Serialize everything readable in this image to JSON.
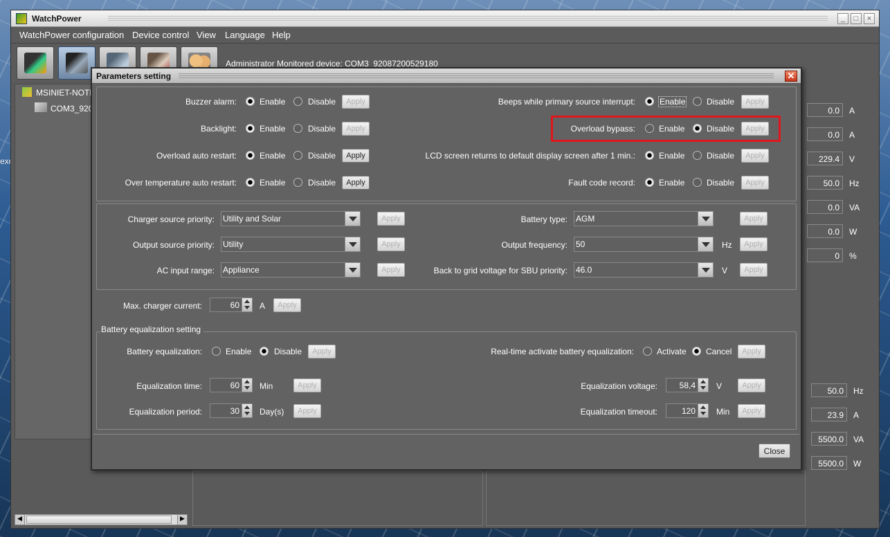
{
  "window": {
    "title": "WatchPower",
    "controls": [
      "_",
      "□",
      "×"
    ]
  },
  "desktop": {
    "text": "exe"
  },
  "menu": [
    "WatchPower configuration",
    "Device control",
    "View",
    "Language",
    "Help"
  ],
  "toolbar": {
    "status": "Administrator   Monitored device:  COM3_92087200529180"
  },
  "tree": {
    "root": "MSINIET-NOTE",
    "child": "COM3_920"
  },
  "side_values": {
    "top": [
      {
        "value": "0.0",
        "unit": "A"
      },
      {
        "value": "0.0",
        "unit": "A"
      },
      {
        "value": "229.4",
        "unit": "V"
      },
      {
        "value": "50.0",
        "unit": "Hz"
      },
      {
        "value": "0.0",
        "unit": "VA"
      },
      {
        "value": "0.0",
        "unit": "W"
      },
      {
        "value": "0",
        "unit": "%"
      }
    ],
    "bottom": [
      {
        "value": "50.0",
        "unit": "Hz"
      },
      {
        "value": "23.9",
        "unit": "A"
      },
      {
        "value": "5500.0",
        "unit": "VA"
      },
      {
        "value": "5500.0",
        "unit": "W"
      }
    ]
  },
  "dialog": {
    "title": "Parameters setting",
    "close_label": "Close",
    "apply": "Apply",
    "enable": "Enable",
    "disable": "Disable",
    "left_toggles": [
      {
        "label": "Buzzer alarm:",
        "value": "Enable"
      },
      {
        "label": "Backlight:",
        "value": "Enable"
      },
      {
        "label": "Overload auto restart:",
        "value": "Enable"
      },
      {
        "label": "Over temperature auto restart:",
        "value": "Enable"
      }
    ],
    "right_toggles": [
      {
        "label": "Beeps while primary source interrupt:",
        "value": "Enable"
      },
      {
        "label": "Overload bypass:",
        "value": "Disable"
      },
      {
        "label": "LCD screen returns to default display screen after 1 min.:",
        "value": "Enable"
      },
      {
        "label": "Fault code record:",
        "value": "Enable"
      }
    ],
    "combos_left": [
      {
        "label": "Charger source priority:",
        "value": "Utility and Solar"
      },
      {
        "label": "Output source priority:",
        "value": "Utility"
      },
      {
        "label": "AC input range:",
        "value": "Appliance"
      }
    ],
    "combos_right": [
      {
        "label": "Battery type:",
        "value": "AGM",
        "unit": ""
      },
      {
        "label": "Output frequency:",
        "value": "50",
        "unit": "Hz"
      },
      {
        "label": "Back to grid voltage for SBU priority:",
        "value": "46.0",
        "unit": "V"
      }
    ],
    "max_charger": {
      "label": "Max. charger current:",
      "value": "60",
      "unit": "A"
    },
    "battery_eq": {
      "group_label": "Battery equalization setting",
      "label": "Battery equalization:",
      "value": "Disable",
      "realtime_label": "Real-time activate battery equalization:",
      "activate": "Activate",
      "cancel": "Cancel",
      "realtime_value": "Cancel",
      "time": {
        "label": "Equalization time:",
        "value": "60",
        "unit": "Min"
      },
      "period": {
        "label": "Equalization period:",
        "value": "30",
        "unit": "Day(s)"
      },
      "voltage": {
        "label": "Equalization voltage:",
        "value": "58,4",
        "unit": "V"
      },
      "timeout": {
        "label": "Equalization timeout:",
        "value": "120",
        "unit": "Min"
      }
    }
  }
}
